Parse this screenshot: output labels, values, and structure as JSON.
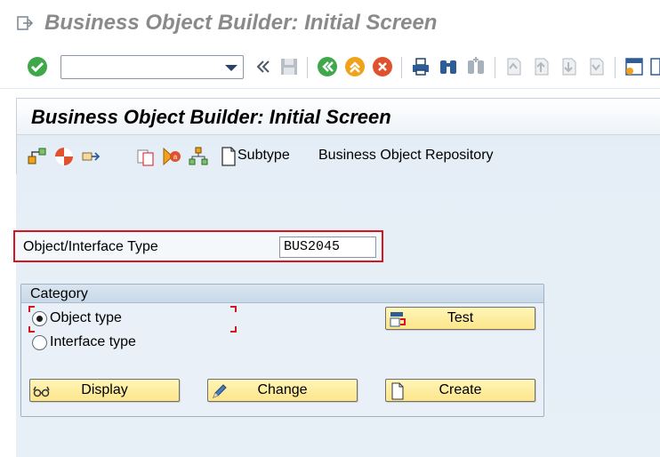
{
  "window": {
    "title": "Business Object Builder: Initial Screen"
  },
  "system_toolbar": {
    "command_field_value": "",
    "command_field_placeholder": "",
    "icons": [
      "enter-icon",
      "command-field",
      "collapse-icon",
      "save-icon",
      "back-icon",
      "exit-icon",
      "cancel-icon",
      "print-icon",
      "find-icon",
      "find-next-icon",
      "first-page-icon",
      "previous-page-icon",
      "next-page-icon",
      "last-page-icon",
      "create-session-icon",
      "shortcut-icon"
    ]
  },
  "screen": {
    "title": "Business Object Builder: Initial Screen"
  },
  "app_toolbar": {
    "icons": [
      "other-object-icon",
      "delete-icon",
      "where-used-icon",
      "copy-icon",
      "program-icon",
      "relationships-icon"
    ],
    "subtype_label": "Subtype",
    "repository_label": "Business Object Repository"
  },
  "form": {
    "field_label": "Object/Interface Type",
    "field_value": "BUS2045"
  },
  "category": {
    "title": "Category",
    "options": [
      {
        "label": "Object type",
        "selected": true
      },
      {
        "label": "Interface type",
        "selected": false
      }
    ]
  },
  "buttons": {
    "test": "Test",
    "display": "Display",
    "change": "Change",
    "create": "Create"
  },
  "colors": {
    "highlight_border": "#d8141e",
    "button_fill": "#fde58a",
    "panel_bg": "#e7eff7"
  }
}
